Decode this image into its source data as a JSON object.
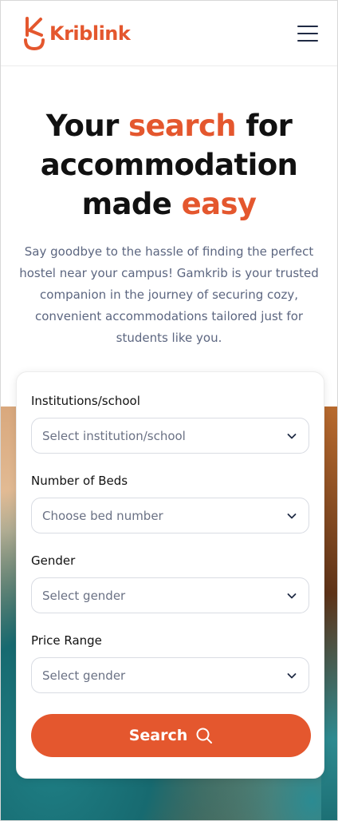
{
  "brand": {
    "name": "Kriblink",
    "accent_color": "#e4572e"
  },
  "header": {
    "menu_icon": "hamburger-menu-icon"
  },
  "hero": {
    "title_part1": "Your ",
    "title_highlight1": "search",
    "title_part2": " for accommodation made ",
    "title_highlight2": "easy",
    "description": "Say goodbye to the hassle of finding the perfect hostel near your campus! Gamkrib is your trusted companion in the journey of securing cozy, convenient accommodations tailored just for students like you."
  },
  "form": {
    "fields": [
      {
        "label": "Institutions/school",
        "placeholder": "Select institution/school"
      },
      {
        "label": "Number of Beds",
        "placeholder": "Choose bed number"
      },
      {
        "label": "Gender",
        "placeholder": "Select gender"
      },
      {
        "label": "Price Range",
        "placeholder": "Select gender"
      }
    ],
    "search_label": "Search"
  }
}
